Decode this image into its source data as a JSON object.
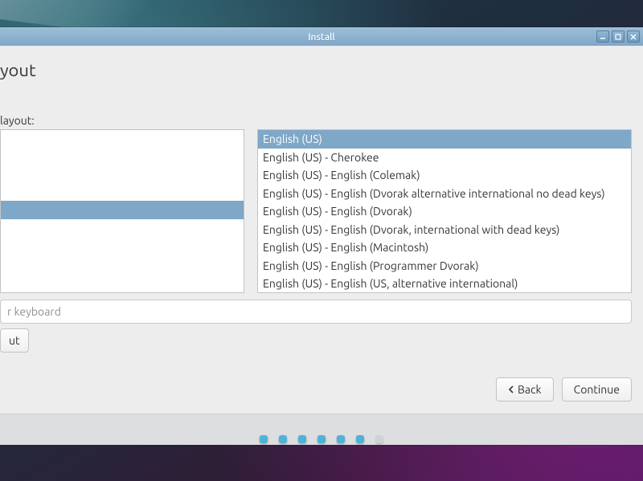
{
  "titlebar": {
    "title": "Install"
  },
  "page": {
    "heading": "yout",
    "section_label": " layout:"
  },
  "left_list": {
    "selected_index": 4
  },
  "right_list": {
    "items": [
      "English (US)",
      "English (US) - Cherokee",
      "English (US) - English (Colemak)",
      "English (US) - English (Dvorak alternative international no dead keys)",
      "English (US) - English (Dvorak)",
      "English (US) - English (Dvorak, international with dead keys)",
      "English (US) - English (Macintosh)",
      "English (US) - English (Programmer Dvorak)",
      "English (US) - English (US, alternative international)"
    ],
    "selected_index": 0
  },
  "test_input": {
    "placeholder": "r keyboard"
  },
  "buttons": {
    "detect": "ut",
    "back": "Back",
    "continue": "Continue"
  },
  "progress": {
    "total": 7,
    "active_count": 6
  }
}
